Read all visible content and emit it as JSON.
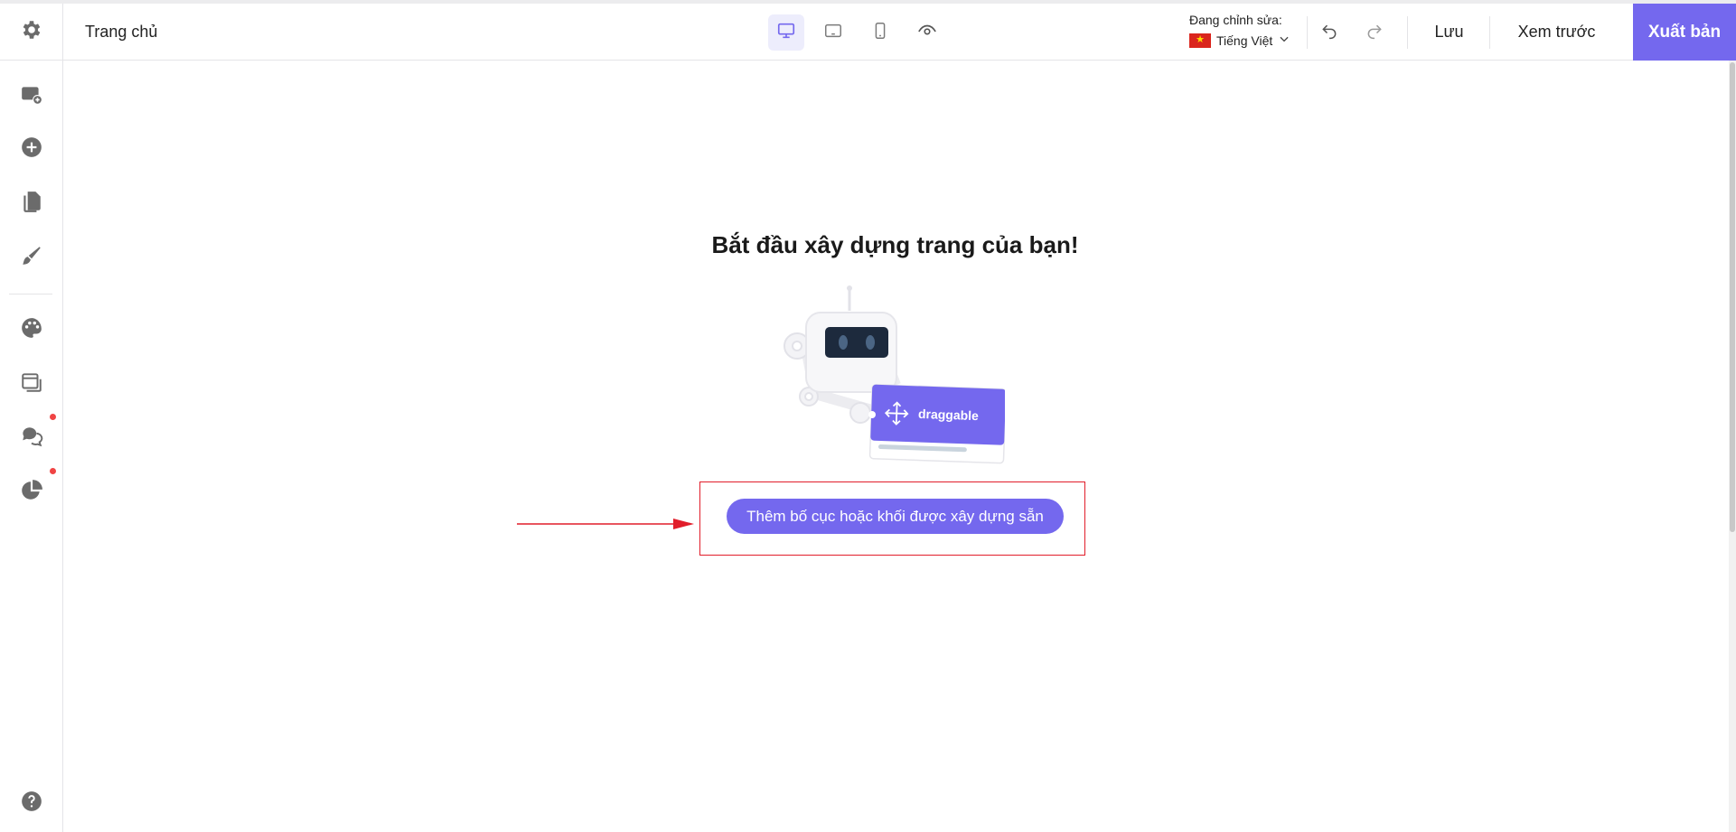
{
  "topbar": {
    "page_name": "Trang chủ",
    "editing_label": "Đang chỉnh sửa:",
    "language": "Tiếng Việt",
    "save_label": "Lưu",
    "preview_label": "Xem trước",
    "publish_label": "Xuất bản",
    "devices": [
      "desktop-icon",
      "tablet-icon",
      "mobile-icon",
      "eye-icon"
    ]
  },
  "sidebar": {
    "items": [
      "add-section-icon",
      "plus-circle-icon",
      "pages-icon",
      "brush-icon",
      "palette-icon",
      "window-icon",
      "chat-icon",
      "pie-chart-icon"
    ],
    "footer": "help-icon"
  },
  "canvas": {
    "headline": "Bắt đầu xây dựng trang của bạn!",
    "illustration_label": "draggable",
    "add_button": "Thêm bố cục hoặc khối được xây dựng sẵn"
  },
  "colors": {
    "accent": "#7468ee",
    "highlight": "#e11d2a",
    "icon": "#6b6b6b"
  }
}
